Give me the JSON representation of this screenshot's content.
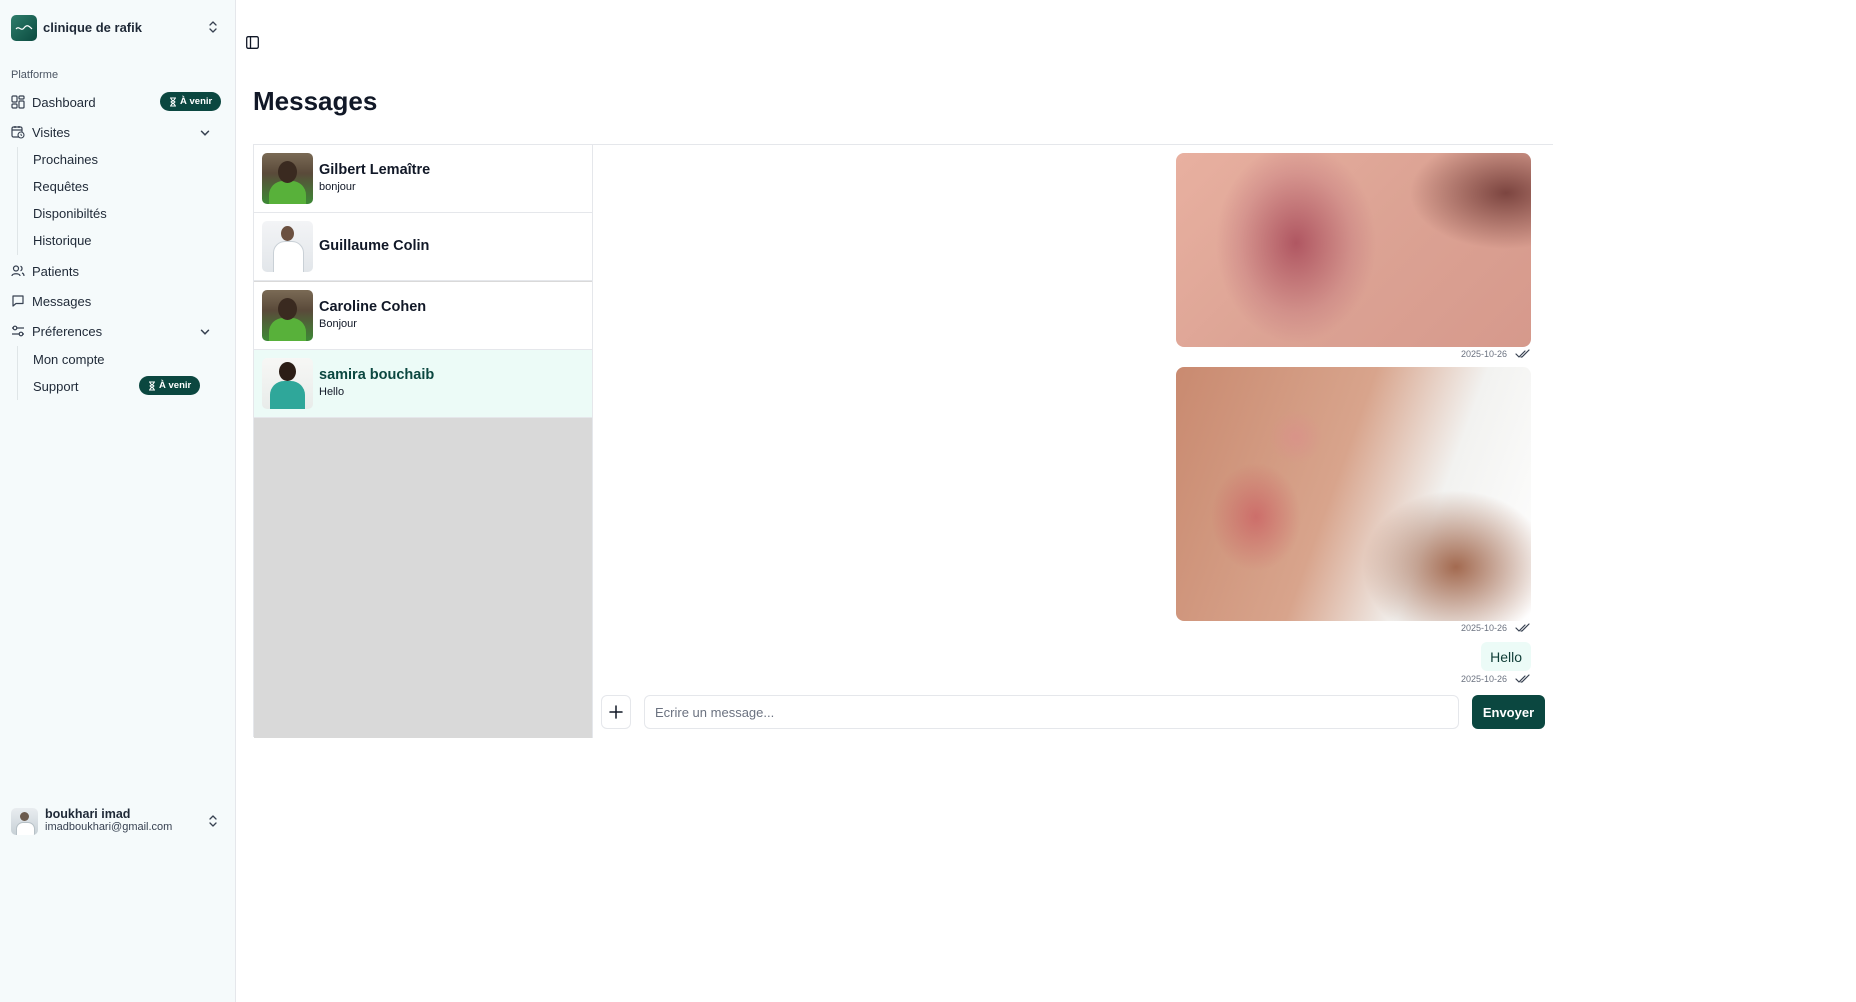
{
  "sidebar": {
    "org_name": "clinique de rafik",
    "section_label": "Platforme",
    "nav": {
      "dashboard": "Dashboard",
      "visites": "Visites",
      "patients": "Patients",
      "messages": "Messages",
      "preferences": "Préferences"
    },
    "badge_upcoming": "À venir",
    "visites_sub": [
      "Prochaines",
      "Requêtes",
      "Disponibiltés",
      "Historique"
    ],
    "preferences_sub": [
      "Mon compte",
      "Support"
    ],
    "user": {
      "name": "boukhari imad",
      "email": "imadboukhari@gmail.com"
    }
  },
  "page": {
    "title": "Messages"
  },
  "conversations": [
    {
      "name": "Gilbert Lemaître",
      "preview": "bonjour",
      "avatar": "green-shirt-person",
      "active": false
    },
    {
      "name": "Guillaume Colin",
      "preview": "",
      "avatar": "doctor-white-coat",
      "active": false
    },
    {
      "name": "Caroline Cohen",
      "preview": "Bonjour",
      "avatar": "green-shirt-person",
      "active": false
    },
    {
      "name": "samira bouchaib",
      "preview": "Hello",
      "avatar": "nurse-teal-scrubs",
      "active": true
    }
  ],
  "chat": {
    "messages": [
      {
        "type": "image",
        "description": "skin-rash-photo",
        "date": "2025-10-26"
      },
      {
        "type": "image",
        "description": "elbow-psoriasis-photo",
        "date": "2025-10-26"
      },
      {
        "type": "text",
        "text": "Hello",
        "date": "2025-10-26"
      }
    ],
    "composer": {
      "placeholder": "Ecrire un message...",
      "value": "",
      "send_label": "Envoyer"
    }
  },
  "colors": {
    "accent": "#0b4740",
    "active_conversation_bg": "#ecfbf7",
    "sidebar_bg": "#f5fafb"
  }
}
